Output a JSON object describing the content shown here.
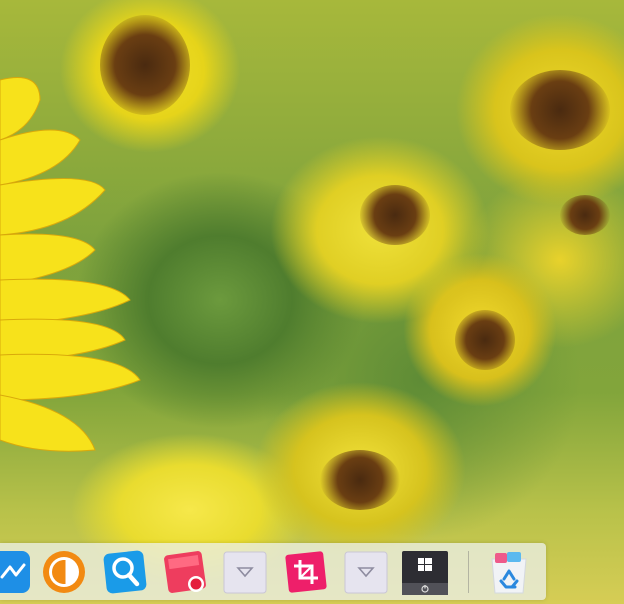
{
  "screen": {
    "wallpaper": "sunflowers-wallpaper"
  },
  "dock": {
    "items": [
      {
        "icon": "app-icon-partial",
        "color": "#1e8fe6"
      },
      {
        "icon": "circle-toggle-icon",
        "color": "#f28a12"
      },
      {
        "icon": "magnifier-icon",
        "color": "#1a9be8"
      },
      {
        "icon": "screen-recorder-icon",
        "color": "#ee3d5e"
      },
      {
        "icon": "dropdown-icon",
        "color": "#e6e4ef"
      },
      {
        "icon": "crop-icon",
        "color": "#ee1f6a"
      },
      {
        "icon": "dropdown-icon",
        "color": "#e6e4ef"
      },
      {
        "icon": "windows-power-icon",
        "color": "#2d2d33"
      },
      {
        "icon": "recycle-bin-icon",
        "color": "#2a88de"
      }
    ]
  }
}
